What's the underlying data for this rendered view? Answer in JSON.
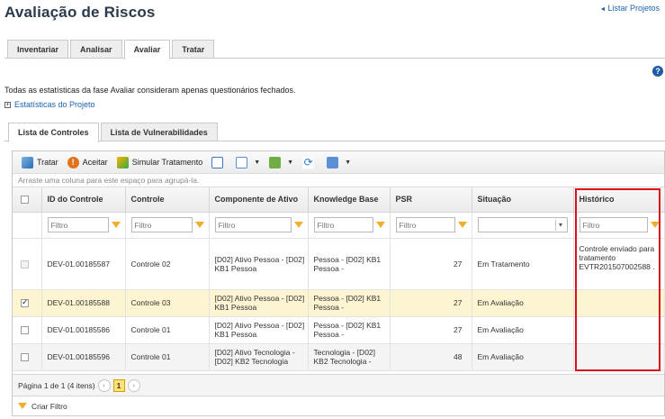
{
  "page": {
    "title": "Avaliação de Riscos",
    "list_link": "Listar Projetos"
  },
  "tabs": [
    "Inventariar",
    "Analisar",
    "Avaliar",
    "Tratar"
  ],
  "note": "Todas as estatísticas da fase Avaliar consideram apenas questionários fechados.",
  "stats_link": "Estatísticas do Projeto",
  "subtabs": [
    "Lista de Controles",
    "Lista de Vulnerabilidades"
  ],
  "toolbar": {
    "treat": "Tratar",
    "accept": "Aceitar",
    "simulate": "Simular Tratamento"
  },
  "group_hint": "Arraste uma coluna para este espaço para agrupá-la.",
  "columns": [
    "ID do Controle",
    "Controle",
    "Componente de Ativo",
    "Knowledge Base",
    "PSR",
    "Situação",
    "Histórico"
  ],
  "filter_placeholder": "Filtro",
  "rows": [
    {
      "id": "DEV-01.00185587",
      "control": "Controle 02",
      "component": "[D02] Ativo Pessoa - [D02] KB1 Pessoa",
      "kb": "Pessoa - [D02] KB1 Pessoa -",
      "psr": "27",
      "status": "Em Tratamento",
      "history": "Controle enviado para tratamento EVTR201507002588 ."
    },
    {
      "id": "DEV-01.00185588",
      "control": "Controle 03",
      "component": "[D02] Ativo Pessoa - [D02] KB1 Pessoa",
      "kb": "Pessoa - [D02] KB1 Pessoa -",
      "psr": "27",
      "status": "Em Avaliação",
      "history": ""
    },
    {
      "id": "DEV-01.00185586",
      "control": "Controle 01",
      "component": "[D02] Ativo Pessoa - [D02] KB1 Pessoa",
      "kb": "Pessoa - [D02] KB1 Pessoa -",
      "psr": "27",
      "status": "Em Avaliação",
      "history": ""
    },
    {
      "id": "DEV-01.00185596",
      "control": "Controle 01",
      "component": "[D02] Ativo Tecnologia - [D02] KB2 Tecnologia",
      "kb": "Tecnologia - [D02] KB2 Tecnologia -",
      "psr": "48",
      "status": "Em Avaliação",
      "history": ""
    }
  ],
  "pager": {
    "text": "Página 1 de 1 (4 itens)",
    "page": "1",
    "prev": "‹",
    "next": "›"
  },
  "footer": {
    "create_filter": "Criar Filtro"
  },
  "icons": {
    "arrow": "◄",
    "plus": "+",
    "help": "?"
  },
  "colors": {
    "link": "#1b62b5",
    "highlight": "#d9121b",
    "selected_row": "#fdf4d2",
    "filter_icon": "#f0ad2e"
  }
}
